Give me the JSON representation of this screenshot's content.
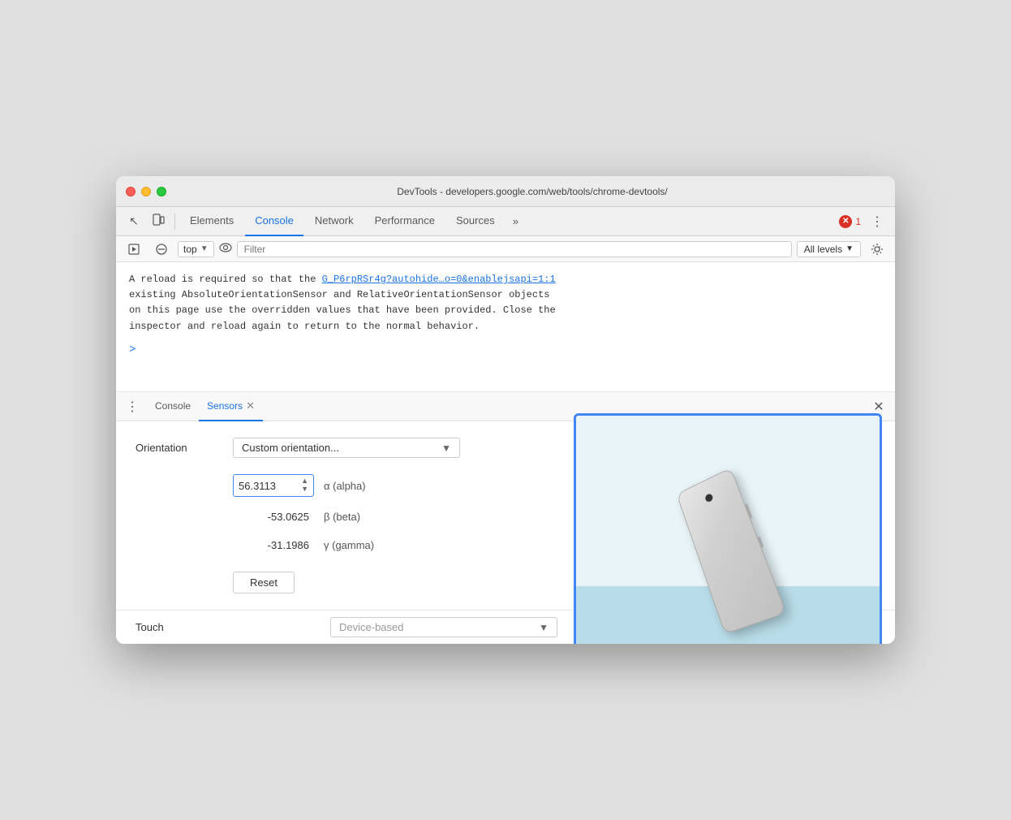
{
  "window": {
    "title": "DevTools - developers.google.com/web/tools/chrome-devtools/"
  },
  "toolbar": {
    "tabs": [
      {
        "id": "elements",
        "label": "Elements",
        "active": false
      },
      {
        "id": "console",
        "label": "Console",
        "active": true
      },
      {
        "id": "network",
        "label": "Network",
        "active": false
      },
      {
        "id": "performance",
        "label": "Performance",
        "active": false
      },
      {
        "id": "sources",
        "label": "Sources",
        "active": false
      }
    ],
    "more_tabs_label": "»",
    "error_count": "1",
    "menu_dots": "⋮"
  },
  "console_toolbar": {
    "context_label": "top",
    "filter_placeholder": "Filter",
    "all_levels_label": "All levels",
    "dropdown_arrow": "▼"
  },
  "console_output": {
    "message_line1": "A reload is required so that the ",
    "message_link": "G_P6rpRSr4g?autohide…o=0&enablejsapi=1:1",
    "message_line2": "existing AbsoluteOrientationSensor and RelativeOrientationSensor objects",
    "message_line3": "on this page use the overridden values that have been provided. Close the",
    "message_line4": "inspector and reload again to return to the normal behavior.",
    "caret": ">"
  },
  "bottom_panel": {
    "tabs": [
      {
        "id": "console",
        "label": "Console",
        "active": false,
        "closable": false
      },
      {
        "id": "sensors",
        "label": "Sensors",
        "active": true,
        "closable": true
      }
    ],
    "close_label": "✕"
  },
  "sensors": {
    "orientation_label": "Orientation",
    "orientation_select_value": "Custom orientation...",
    "alpha_value": "56.3113",
    "alpha_label": "α (alpha)",
    "beta_value": "-53.0625",
    "beta_label": "β (beta)",
    "gamma_value": "-31.1986",
    "gamma_label": "γ (gamma)",
    "reset_label": "Reset",
    "touch_label": "Touch",
    "touch_select_value": "Device-based",
    "touch_dropdown": "▼"
  },
  "icons": {
    "cursor": "↖",
    "mobile": "⧉",
    "no_entry": "🚫",
    "eye": "👁",
    "gear": "⚙",
    "up_arrow": "▲",
    "down_arrow": "▼",
    "more_vert": "⋮",
    "close": "✕"
  },
  "colors": {
    "accent_blue": "#4285f4",
    "active_tab": "#1a73e8",
    "error_red": "#d93025"
  }
}
